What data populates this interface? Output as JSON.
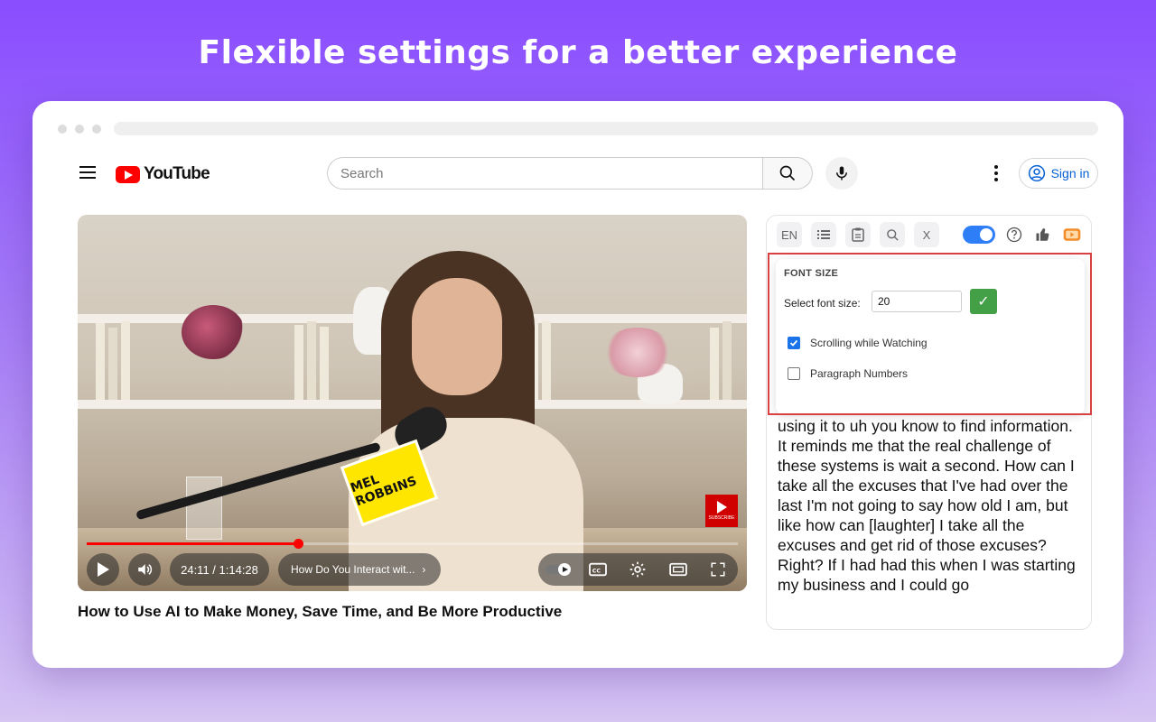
{
  "headline": "Flexible settings for a better experience",
  "youtube": {
    "logo_text": "YouTube",
    "search_placeholder": "Search",
    "sign_in": "Sign in"
  },
  "video": {
    "time": "24:11 / 1:14:28",
    "chapter": "How Do You Interact wit...",
    "title": "How to Use AI to Make Money, Save Time, and Be More Productive",
    "progress": 0.325,
    "mic_flag_text": "MEL ROBBINS",
    "subscribe_label": "SUBSCRIBE"
  },
  "extension": {
    "toolbar": {
      "lang": "EN",
      "close": "X",
      "enabled": true
    },
    "settings": {
      "title": "FONT SIZE",
      "font_label": "Select font size:",
      "font_value": "20",
      "confirm": "✓",
      "options": [
        {
          "label": "Scrolling while Watching",
          "checked": true
        },
        {
          "label": "Paragraph Numbers",
          "checked": false
        }
      ]
    },
    "transcript": "using it to uh you know to find information. It reminds me that the real challenge of these systems is wait a second. How can I take all the excuses that I've had over the last I'm not going to say how old I am, but like how can [laughter] I take all the excuses and get rid of those excuses? Right? If I had had this when I was starting my business and I could go"
  }
}
